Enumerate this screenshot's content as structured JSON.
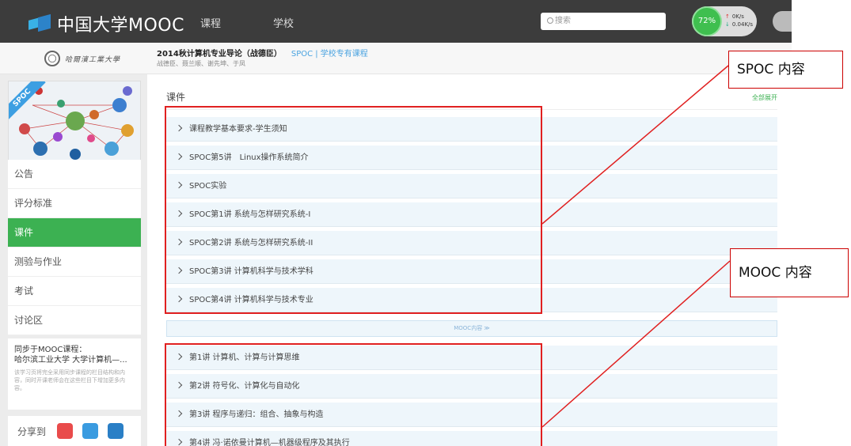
{
  "topbar": {
    "brand": "中国大学MOOC",
    "nav": [
      "课程",
      "学校"
    ],
    "search_placeholder": "搜索",
    "speed": {
      "percent": "72%",
      "up": "0K/s",
      "down": "0.04K/s"
    }
  },
  "course": {
    "title": "2014秋计算机专业导论（战德臣）",
    "tag": "SPOC | 学校专有课程",
    "authors": "战德臣、聂兰顺、谢先坤、于凤"
  },
  "sidebar": {
    "ribbon": "SPOC",
    "menu": [
      "公告",
      "评分标准",
      "课件",
      "测验与作业",
      "考试",
      "讨论区"
    ],
    "active_index": 2,
    "sync": {
      "title": "同步于MOOC课程：",
      "course": "哈尔滨工业大学 大学计算机—...",
      "desc": "该学习页将完全采用同步课程的栏目结构和内容，同时开课老师会在这些栏目下增加更多内容。"
    },
    "share_label": "分享到"
  },
  "main": {
    "section_title": "课件",
    "toggle_all": "全部展开",
    "spoc_chapters": [
      "课程教学基本要求-学生须知",
      "SPOC第5讲　Linux操作系统简介",
      "SPOC实验",
      "SPOC第1讲 系统与怎样研究系统-I",
      "SPOC第2讲 系统与怎样研究系统-II",
      "SPOC第3讲 计算机科学与技术学科",
      "SPOC第4讲 计算机科学与技术专业"
    ],
    "mooc_divider": "MOOC内容 ≫",
    "mooc_chapters": [
      "第1讲 计算机、计算与计算思维",
      "第2讲 符号化、计算化与自动化",
      "第3讲 程序与递归：组合、抽象与构造",
      "第4讲 冯·诺依曼计算机—机器级程序及其执行"
    ]
  },
  "annotations": {
    "spoc_label": "SPOC 内容",
    "mooc_label": "MOOC 内容",
    "box_color": "#e02020"
  }
}
